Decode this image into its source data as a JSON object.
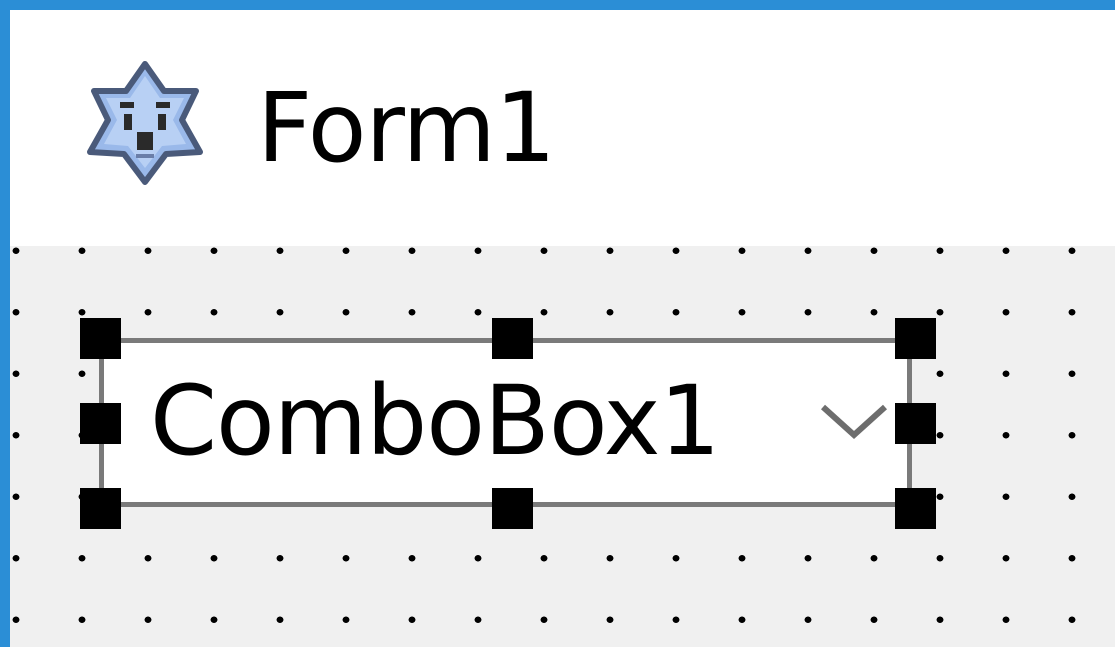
{
  "window": {
    "title": "Form1",
    "icon": "form-gear-icon"
  },
  "designer": {
    "grid": "dotted",
    "combobox": {
      "text": "ComboBox1",
      "dropdown_icon": "chevron-down-icon",
      "selected": true
    }
  },
  "colors": {
    "window_border": "#2b8ed6",
    "client_background": "#f0f0f0",
    "selection_handle": "#000000"
  }
}
